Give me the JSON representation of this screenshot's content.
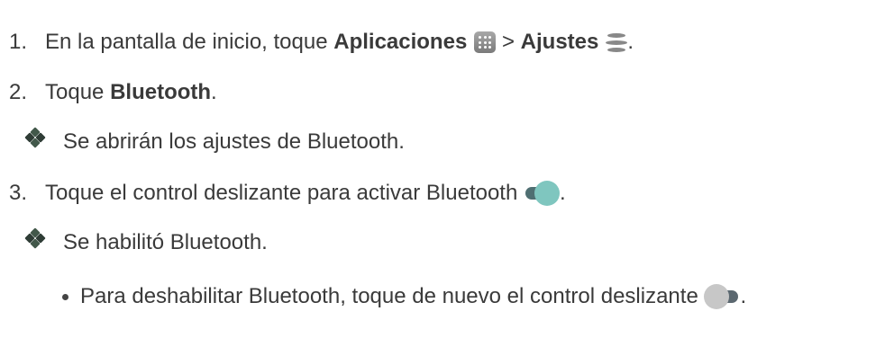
{
  "steps": [
    {
      "number": "1.",
      "text_before": "En la pantalla de inicio, toque ",
      "bold_1": "Aplicaciones",
      "separator": " > ",
      "bold_2": "Ajustes",
      "text_after": "."
    },
    {
      "number": "2.",
      "text_before": "Toque ",
      "bold_1": "Bluetooth",
      "text_after": "."
    },
    {
      "number": "3.",
      "text_before": "Toque el control deslizante para activar Bluetooth ",
      "text_after": "."
    }
  ],
  "results": [
    "Se abrirán los ajustes de Bluetooth.",
    "Se habilitó Bluetooth."
  ],
  "bullets": [
    {
      "text": "Para deshabilitar Bluetooth, toque de nuevo el control deslizante ",
      "text_after": "."
    }
  ],
  "icons": {
    "apps": "apps-grid-icon",
    "settings": "settings-icon",
    "toggle_on": "toggle-on-icon",
    "toggle_off": "toggle-off-icon",
    "result": "diamond-bullet-icon"
  },
  "colors": {
    "text": "#3a3a3a",
    "toggle_on_knob": "#7fc6bf",
    "toggle_on_track": "#4f6f72",
    "toggle_off_knob": "#c7c7c7",
    "toggle_off_track": "#5b6870",
    "diamond": "#2f3d36"
  }
}
